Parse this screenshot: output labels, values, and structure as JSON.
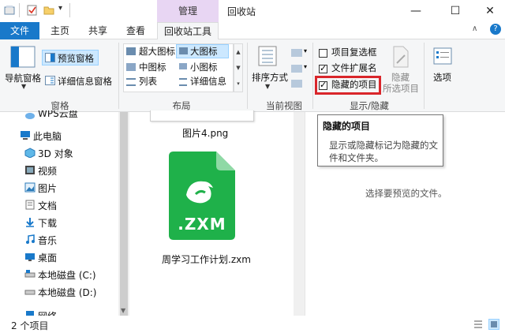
{
  "titlebar": {
    "manage_tab": "管理",
    "window_title": "回收站",
    "minimize": "—",
    "maximize": "☐",
    "close": "✕"
  },
  "ribbon_tabs": {
    "file": "文件",
    "home": "主页",
    "share": "共享",
    "view": "查看",
    "recycle_tools": "回收站工具",
    "help": "?"
  },
  "ribbon": {
    "panes": {
      "nav_pane": "导航窗格",
      "preview_pane": "预览窗格",
      "details_pane": "详细信息窗格",
      "group_label": "窗格"
    },
    "layout": {
      "extra_large_icons": "超大图标",
      "large_icons": "大图标",
      "medium_icons": "中图标",
      "small_icons": "小图标",
      "list": "列表",
      "details": "详细信息",
      "group_label": "布局"
    },
    "current_view": {
      "sort_by": "排序方式",
      "group_label": "当前视图"
    },
    "show_hide": {
      "item_checkboxes": "项目复选框",
      "file_extensions": "文件扩展名",
      "hidden_items": "隐藏的项目",
      "hide_selected_line1": "隐藏",
      "hide_selected_line2": "所选项目",
      "group_label": "显示/隐藏",
      "item_checkboxes_checked": false,
      "file_extensions_checked": true,
      "hidden_items_checked": true
    },
    "options": "选项"
  },
  "nav": {
    "items": [
      {
        "label": "WPS云盘",
        "icon": "cloud-icon"
      },
      {
        "label": "此电脑",
        "icon": "computer-icon"
      },
      {
        "label": "3D 对象",
        "icon": "3d-objects-icon"
      },
      {
        "label": "视频",
        "icon": "video-icon"
      },
      {
        "label": "图片",
        "icon": "pictures-icon"
      },
      {
        "label": "文档",
        "icon": "documents-icon"
      },
      {
        "label": "下载",
        "icon": "download-icon"
      },
      {
        "label": "音乐",
        "icon": "music-icon"
      },
      {
        "label": "桌面",
        "icon": "desktop-icon"
      },
      {
        "label": "本地磁盘 (C:)",
        "icon": "drive-c-icon"
      },
      {
        "label": "本地磁盘 (D:)",
        "icon": "drive-d-icon"
      },
      {
        "label": "网络",
        "icon": "network-icon"
      }
    ]
  },
  "files": [
    {
      "name": "图片4.png",
      "icon": "image-file-icon"
    },
    {
      "name": "周学习工作计划.zxm",
      "icon": "zxm-file-icon",
      "badge": ".ZXM"
    }
  ],
  "tooltip": {
    "title": "隐藏的项目",
    "body": "显示或隐藏标记为隐藏的文件和文件夹。"
  },
  "preview": {
    "message": "选择要预览的文件。"
  },
  "status": {
    "item_count": "2 个项目"
  },
  "colors": {
    "accent": "#1979ca",
    "context_tab": "#e8d6f3",
    "highlight_border": "#d9262b",
    "zxm_green": "#1fb14a"
  }
}
